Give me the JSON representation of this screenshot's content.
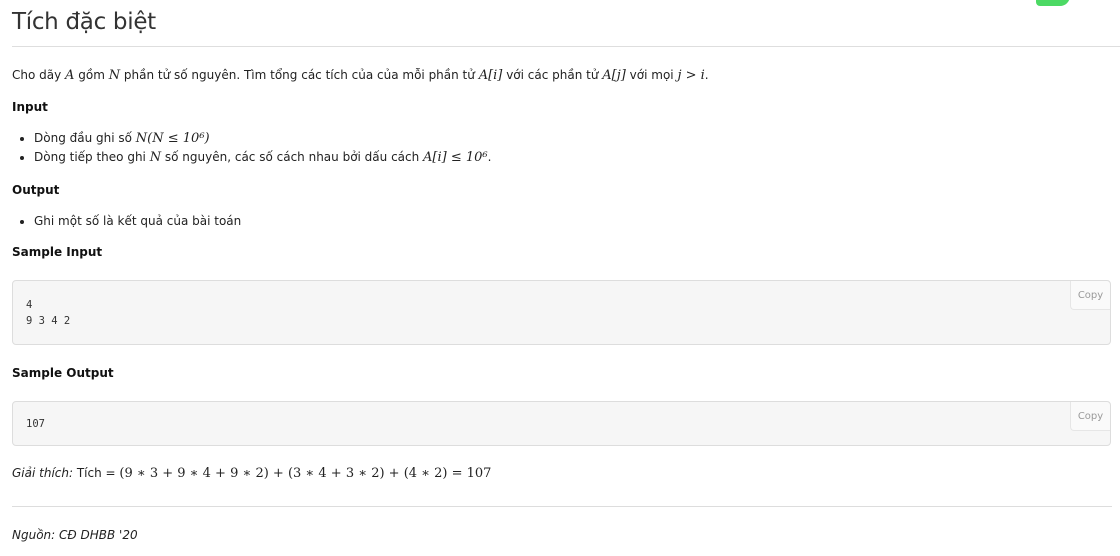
{
  "page": {
    "title": "Tích đặc biệt",
    "accent_color": "#4cd964"
  },
  "statement": {
    "p1": "Cho dãy ",
    "m_A": "A",
    "p2": " gồm ",
    "m_N": "N",
    "p3": " phần tử số nguyên. Tìm tổng các tích của của mỗi phần tử ",
    "m_Ai": "A[i]",
    "p4": " với các phần tử ",
    "m_Aj": "A[j]",
    "p5": " với mọi ",
    "m_cond": "j > i",
    "p6": "."
  },
  "input": {
    "heading": "Input",
    "items": [
      {
        "text": "Dòng đầu ghi số ",
        "math": "N(N ≤ 10⁶)",
        "after": ""
      },
      {
        "text": "Dòng tiếp theo ghi ",
        "math_n": "N",
        "text2": " số nguyên, các số cách nhau bởi dấu cách ",
        "math": "A[i] ≤ 10⁶",
        "after": "."
      }
    ]
  },
  "output": {
    "heading": "Output",
    "items": [
      {
        "text": "Ghi một số là kết quả của bài toán"
      }
    ]
  },
  "sample_input": {
    "heading": "Sample Input",
    "code": "4\n9 3 4 2",
    "copy_label": "Copy"
  },
  "sample_output": {
    "heading": "Sample Output",
    "code": "107",
    "copy_label": "Copy"
  },
  "explanation": {
    "label": "Giải thích:",
    "text": " Tích = ",
    "math": "(9 ∗ 3 + 9 ∗ 4 + 9 ∗ 2) + (3 ∗ 4 + 3 ∗ 2) + (4 ∗ 2) = 107"
  },
  "source": {
    "text": "Nguồn: CĐ DHBB '20"
  }
}
